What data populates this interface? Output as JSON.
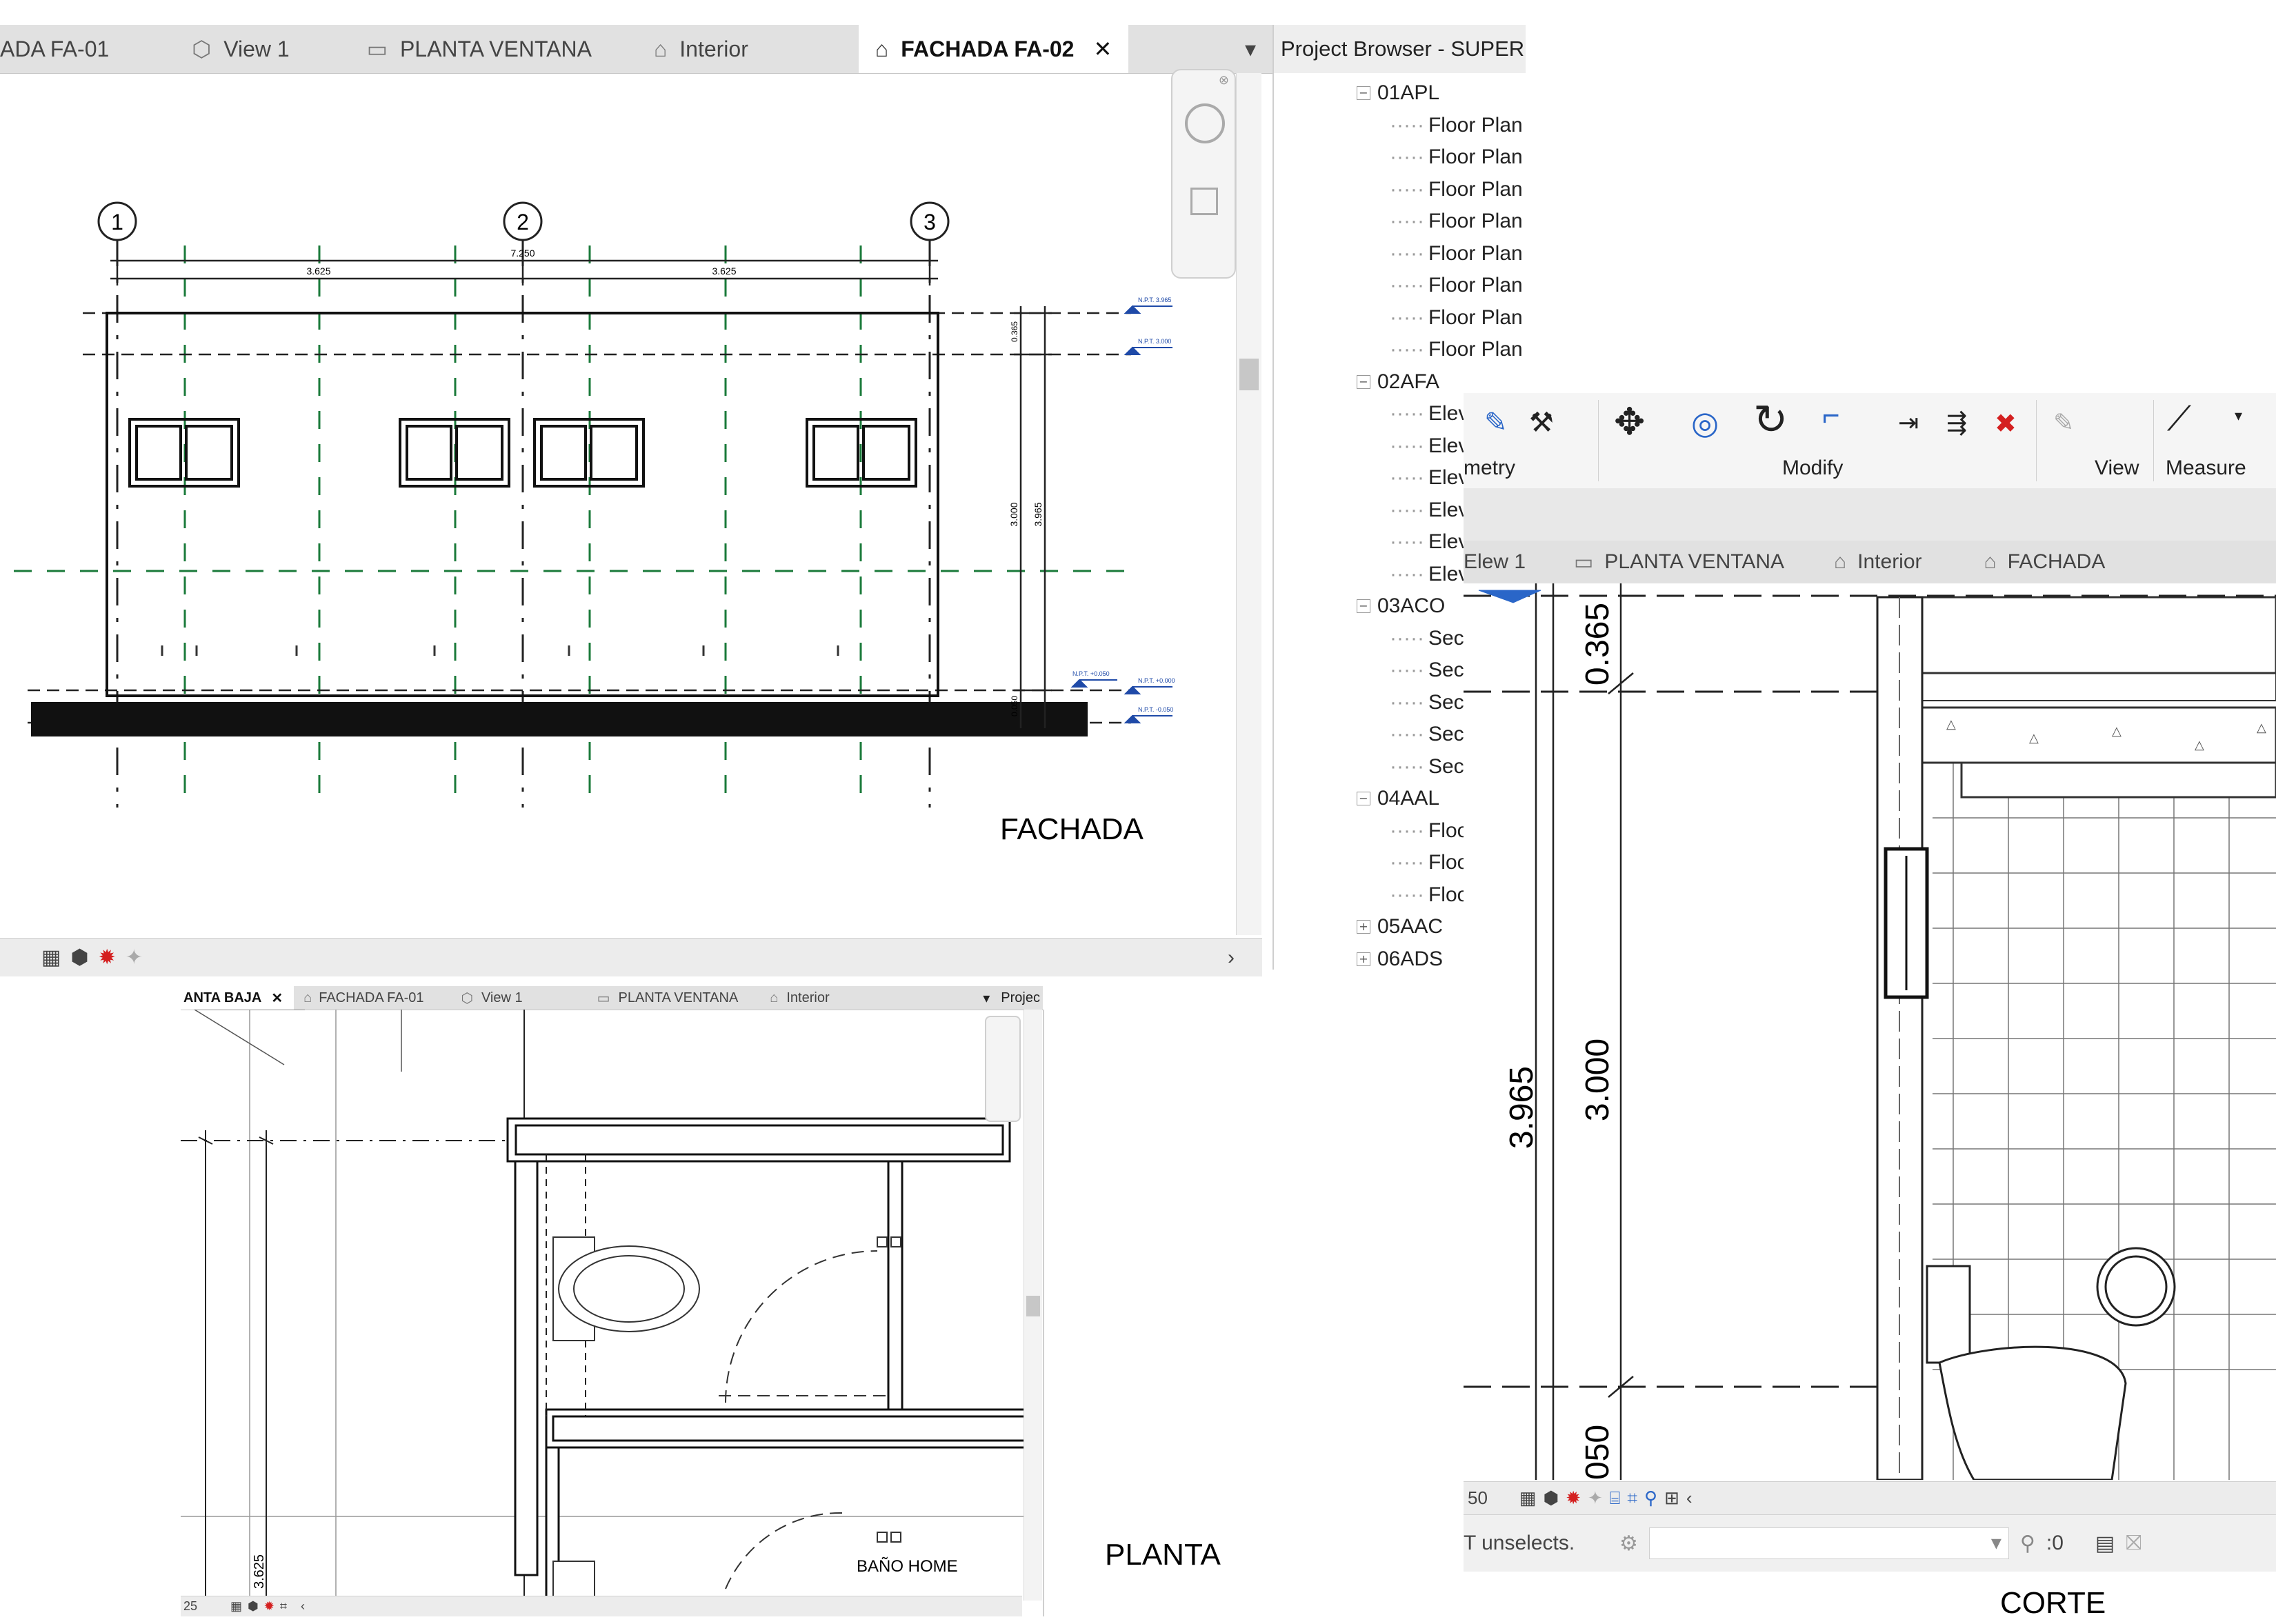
{
  "fachada": {
    "tabs": [
      {
        "label": "ADA FA-01",
        "icon": "",
        "active": false
      },
      {
        "label": "View 1",
        "icon": "3d-view-icon",
        "active": false
      },
      {
        "label": "PLANTA VENTANA",
        "icon": "floor-plan-icon",
        "active": false
      },
      {
        "label": "Interior",
        "icon": "elevation-icon",
        "active": false
      },
      {
        "label": "FACHADA FA-02",
        "icon": "elevation-icon",
        "active": true
      }
    ],
    "grid_bubbles": [
      "1",
      "2",
      "3"
    ],
    "dim_total": "7.250",
    "dim_left": "3.625",
    "dim_right": "3.625",
    "dim_vertical": [
      "3.000",
      "3.965",
      "0.365",
      "0.050"
    ],
    "level_tags": [
      "N.P.T. 3.965",
      "N.P.T. 3.000",
      "N.P.T. +0.050",
      "N.P.T. +0.000",
      "N.P.T. -0.050"
    ],
    "caption": "FACHADA"
  },
  "project_browser": {
    "title": "Project Browser - SUPERM",
    "groups": [
      {
        "label": "01APL",
        "expanded": true,
        "children": [
          "Floor Plan",
          "Floor Plan",
          "Floor Plan",
          "Floor Plan",
          "Floor Plan",
          "Floor Plan",
          "Floor Plan",
          "Floor Plan"
        ]
      },
      {
        "label": "02AFA",
        "expanded": true,
        "children": [
          "Elevation",
          "Elev",
          "Elev",
          "Elev",
          "Elev",
          "Elev"
        ]
      },
      {
        "label": "03ACO",
        "expanded": true,
        "children": [
          "Sec",
          "Sec",
          "Sec",
          "Sec",
          "Sec"
        ]
      },
      {
        "label": "04AAL",
        "expanded": true,
        "children": [
          "Floo",
          "Floo",
          "Floo"
        ]
      },
      {
        "label": "05AAC",
        "expanded": false,
        "children": []
      },
      {
        "label": "06ADS",
        "expanded": false,
        "children": []
      }
    ]
  },
  "planta": {
    "tabs": [
      {
        "label": "ANTA BAJA",
        "active": true
      },
      {
        "label": "FACHADA FA-01",
        "active": false
      },
      {
        "label": "View 1",
        "active": false
      },
      {
        "label": "PLANTA VENTANA",
        "active": false
      },
      {
        "label": "Interior",
        "active": false
      }
    ],
    "browser_title": "Projec",
    "dim_label": "3.625",
    "room_label": "BAÑO HOME",
    "scale": "25",
    "caption": "PLANTA"
  },
  "corte": {
    "ribbon": {
      "panel_geometry": "metry",
      "panel_modify": "Modify",
      "panel_view": "View",
      "panel_measure": "Measure"
    },
    "tabs": [
      {
        "label": "Elew 1",
        "active": false
      },
      {
        "label": "PLANTA VENTANA",
        "active": false
      },
      {
        "label": "Interior",
        "active": false
      },
      {
        "label": "FACHADA",
        "active": false
      }
    ],
    "dims": [
      "0.365",
      "3.965",
      "3.000",
      "050"
    ],
    "scale": "50",
    "status_text": "T unselects.",
    "filter_count": ":0",
    "caption": "CORTE"
  },
  "colors": {
    "grid_green": "#1a7a3a",
    "tab_bg": "#e1e1e1",
    "accent_red": "#d42020",
    "status_bg": "#ececec"
  }
}
